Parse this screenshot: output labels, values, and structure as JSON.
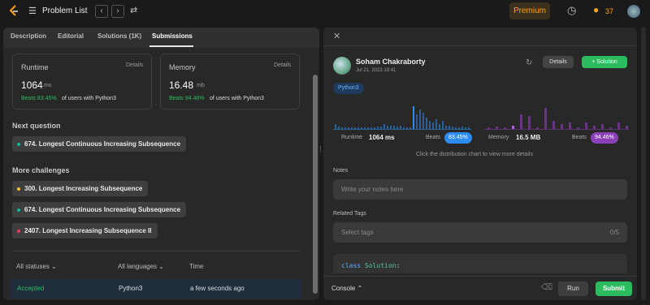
{
  "nav": {
    "title": "Problem List",
    "premium": "Premium",
    "streak": "37"
  },
  "left": {
    "tabs": [
      "Description",
      "Editorial",
      "Solutions (1K)",
      "Submissions"
    ],
    "runtime": {
      "label": "Runtime",
      "details": "Details",
      "value": "1064",
      "unit": "ms",
      "beats": "Beats 83.45%",
      "suffix": "of users with Python3"
    },
    "memory": {
      "label": "Memory",
      "details": "Details",
      "value": "16.48",
      "unit": "mb",
      "beats": "Beats 94.46%",
      "suffix": "of users with Python3"
    },
    "next_heading": "Next question",
    "next_items": [
      {
        "label": "674. Longest Continuous Increasing Subsequence",
        "difficulty": "easy"
      }
    ],
    "more_heading": "More challenges",
    "more_items": [
      {
        "label": "300. Longest Increasing Subsequence",
        "difficulty": "medium"
      },
      {
        "label": "674. Longest Continuous Increasing Subsequence",
        "difficulty": "easy"
      },
      {
        "label": "2407. Longest Increasing Subsequence II",
        "difficulty": "hard"
      }
    ],
    "filters": {
      "statuses": "All statuses",
      "languages": "All languages",
      "time": "Time"
    },
    "row": {
      "status": "Accepted",
      "language": "Python3",
      "time": "a few seconds ago"
    }
  },
  "right": {
    "user": "Soham Chakraborty",
    "date": "Jul 21, 2023 19:41",
    "details_btn": "Details",
    "solution_btn": "Solution",
    "lang_tag": "Python3",
    "runtime_label": "Runtime",
    "runtime_value": "1064 ms",
    "beats_label": "Beats",
    "runtime_pct": "83.45%",
    "memory_label": "Memory",
    "memory_value": "16.5 MB",
    "memory_pct": "94.46%",
    "hint": "Click the distribution chart to view more details",
    "notes_label": "Notes",
    "notes_placeholder": "Write your notes here",
    "tags_label": "Related Tags",
    "tags_placeholder": "Select tags",
    "tags_count": "0/5",
    "code_kw": "class",
    "code_name": "Solution",
    "code_colon": ":",
    "console": "Console",
    "run": "Run",
    "submit": "Submit"
  },
  "colors": {
    "accent_green": "#2cbb5d",
    "blue": "#2d8cf0",
    "purple": "#8b3fb8",
    "easy": "#00b8a3",
    "medium": "#ffc01e",
    "hard": "#ff375f"
  }
}
